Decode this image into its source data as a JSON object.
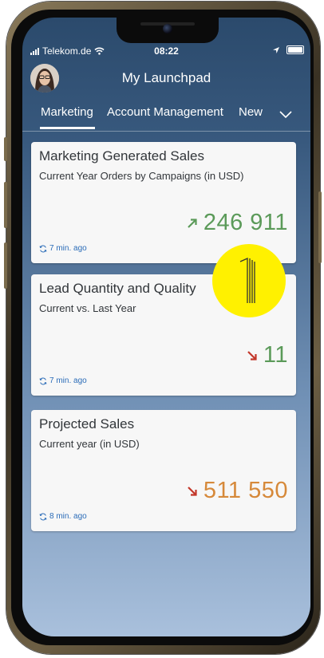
{
  "status_bar": {
    "carrier": "Telekom.de",
    "time": "08:22"
  },
  "header": {
    "title": "My Launchpad"
  },
  "tabs": [
    {
      "label": "Marketing",
      "active": true
    },
    {
      "label": "Account Management",
      "active": false
    },
    {
      "label": "New",
      "active": false
    }
  ],
  "tiles": [
    {
      "title": "Marketing Generated Sales",
      "subtitle": "Current Year Orders by Campaigns (in USD)",
      "value": "246 911",
      "trend": "up",
      "value_color": "#5b9a59",
      "trend_color": "#5b9a59",
      "refresh": "7 min. ago"
    },
    {
      "title": "Lead Quantity and Quality",
      "subtitle": "Current vs. Last Year",
      "value": "11",
      "trend": "down",
      "value_color": "#5b9a59",
      "trend_color": "#c3372a",
      "refresh": "7 min. ago"
    },
    {
      "title": "Projected Sales",
      "subtitle": "Current year (in USD)",
      "value": "511 550",
      "trend": "down",
      "value_color": "#d6893a",
      "trend_color": "#c3372a",
      "refresh": "8 min. ago"
    }
  ],
  "colors": {
    "link": "#2b6cb8",
    "touch_indicator": "#fff100"
  },
  "icons": {
    "touch": "single-finger-tap-icon",
    "refresh": "refresh-icon",
    "trend_up": "arrow-up-right-icon",
    "trend_down": "arrow-down-right-icon"
  }
}
